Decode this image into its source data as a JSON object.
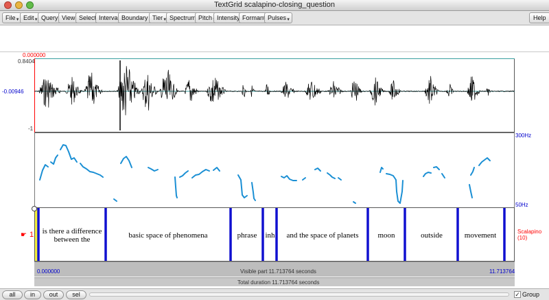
{
  "window": {
    "title": "TextGrid scalapino-closing_question"
  },
  "menu": {
    "items": [
      "File",
      "Edit",
      "Query",
      "View",
      "Select",
      "Interval",
      "Boundary",
      "Tier",
      "Spectrum",
      "Pitch",
      "Intensity",
      "Formant",
      "Pulses"
    ],
    "help": "Help"
  },
  "waveform": {
    "cursor_time": "0.000000",
    "max_value": "0.8404",
    "zero_value": "-0.00946",
    "min_value": "-1"
  },
  "pitch": {
    "top_label": "300Hz",
    "bottom_label": "50Hz"
  },
  "tier": {
    "number": "1",
    "name": "Scalapino",
    "count": "(10)",
    "intervals": [
      {
        "text": "is there a difference between the"
      },
      {
        "text": "basic space of phenomena"
      },
      {
        "text": "phrase"
      },
      {
        "text": "inh"
      },
      {
        "text": "and the space of planets"
      },
      {
        "text": "moon"
      },
      {
        "text": "outside"
      },
      {
        "text": "movement"
      }
    ]
  },
  "time": {
    "start": "0.000000",
    "end": "11.713764",
    "visible": "Visible part 11.713764 seconds",
    "total": "Total duration 11.713764 seconds"
  },
  "zoom": {
    "all": "all",
    "in": "in",
    "out": "out",
    "sel": "sel"
  },
  "group": {
    "label": "Group",
    "checked": "✓"
  },
  "colors": {
    "pitch": "#1a8fd4",
    "boundary": "#1010d0",
    "cursor_red": "#ff0000",
    "selected_interval": "#f2ee3a"
  }
}
